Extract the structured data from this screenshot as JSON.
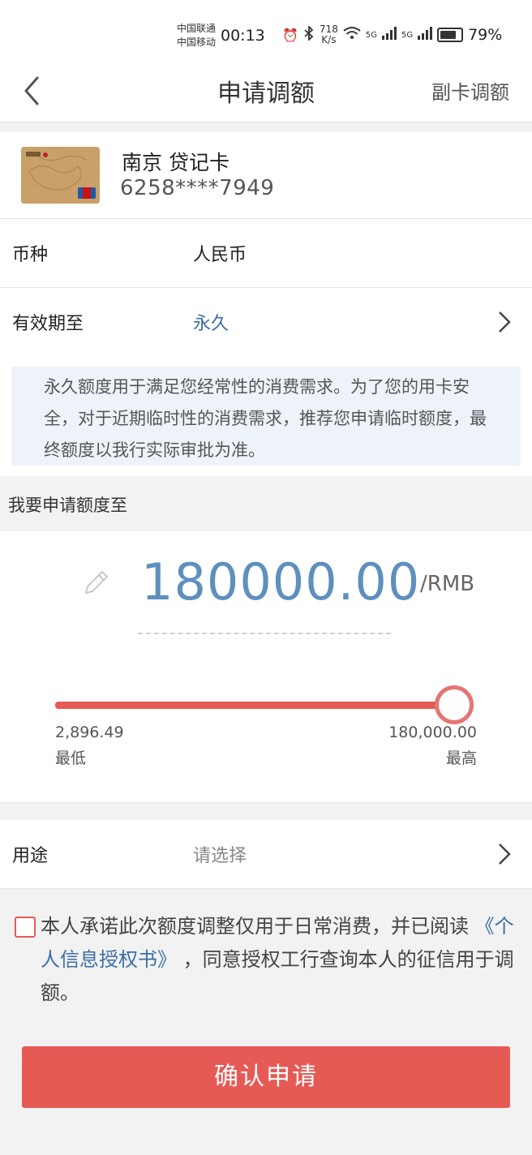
{
  "status_bar": {
    "carrier_1": "中国联通",
    "carrier_2": "中国移动",
    "time": "00:13",
    "net_speed_value": "718",
    "net_speed_unit": "K/s",
    "signal_1_label": "5G",
    "signal_2_label": "5G",
    "battery_percent": "79%",
    "battery_level": 0.79
  },
  "header": {
    "title": "申请调额",
    "right_action": "副卡调额"
  },
  "card": {
    "name": "南京  贷记卡",
    "number": "6258****7949"
  },
  "currency_row": {
    "label": "币种",
    "value": "人民币"
  },
  "validity_row": {
    "label": "有效期至",
    "value": "永久"
  },
  "notice": {
    "text": "永久额度用于满足您经常性的消费需求。为了您的用卡安全，对于近期临时性的消费需求，推荐您申请临时额度，最终额度以我行实际审批为准。"
  },
  "amount_section": {
    "title": "我要申请额度至",
    "amount": "180000.00",
    "unit": "/RMB",
    "slider": {
      "min_value": "2,896.49",
      "min_label": "最低",
      "max_value": "180,000.00",
      "max_label": "最高",
      "position": 1.0
    }
  },
  "usage_row": {
    "label": "用途",
    "placeholder": "请选择"
  },
  "agreement": {
    "text_before": "本人承诺此次额度调整仅用于日常消费，并已阅读 ",
    "link_text": "《个人信息授权书》",
    "text_after": " ，同意授权工行查询本人的征信用于调额。",
    "checked": false
  },
  "confirm_button": {
    "label": "确认申请"
  },
  "colors": {
    "accent_red": "#e65a55",
    "link_blue": "#3a6ea8",
    "amount_blue": "#5e8fbf",
    "notice_bg": "#eef3fa"
  }
}
